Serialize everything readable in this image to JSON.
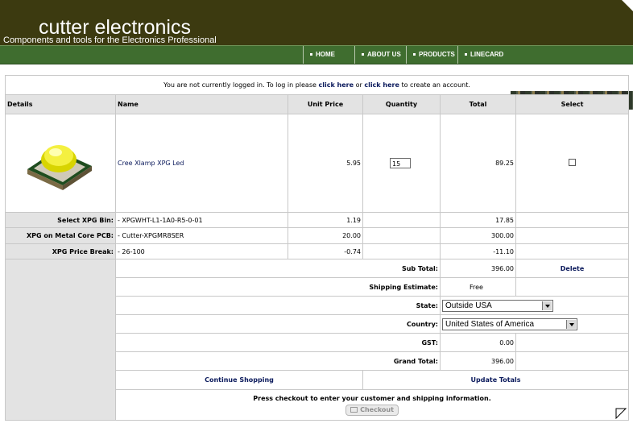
{
  "brand": {
    "name": "cutter electronics",
    "tagline": "Components and tools for the Electronics Professional"
  },
  "nav": [
    {
      "label": "HOME"
    },
    {
      "label": "ABOUT US"
    },
    {
      "label": "PRODUCTS"
    },
    {
      "label": "LINECARD"
    }
  ],
  "login": {
    "prefix": "You are not currently logged in. To log in please ",
    "login_link": "click here",
    "middle": " or ",
    "create_link": "click here",
    "suffix": " to create an account."
  },
  "columns": {
    "details": "Details",
    "name": "Name",
    "unit_price": "Unit Price",
    "quantity": "Quantity",
    "total": "Total",
    "select": "Select"
  },
  "product": {
    "name": "Cree Xlamp XPG Led",
    "unit_price": "5.95",
    "quantity": "15",
    "total": "89.25"
  },
  "options": [
    {
      "label": "Select XPG Bin:",
      "value": "- XPGWHT-L1-1A0-R5-0-01",
      "unit_price": "1.19",
      "total": "17.85"
    },
    {
      "label": "XPG on Metal Core PCB:",
      "value": "- Cutter-XPGMR8SER",
      "unit_price": "20.00",
      "total": "300.00"
    },
    {
      "label": "XPG Price Break:",
      "value": "- 26-100",
      "unit_price": "-0.74",
      "total": "-11.10"
    }
  ],
  "summary": {
    "subtotal_label": "Sub Total:",
    "subtotal": "396.00",
    "delete": "Delete",
    "shipping_label": "Shipping Estimate:",
    "shipping": "Free",
    "state_label": "State:",
    "state_value": "Outside USA",
    "country_label": "Country:",
    "country_value": "United States of America",
    "gst_label": "GST:",
    "gst": "0.00",
    "grand_label": "Grand Total:",
    "grand": "396.00"
  },
  "actions": {
    "continue": "Continue Shopping",
    "update": "Update Totals",
    "checkout_note": "Press checkout to enter your customer and shipping information.",
    "checkout": "Checkout"
  },
  "colors": {
    "header_bg": "#3c3a10",
    "nav_bg": "#3f6d2f",
    "link": "#0b1a5c",
    "free": "#d00000"
  }
}
